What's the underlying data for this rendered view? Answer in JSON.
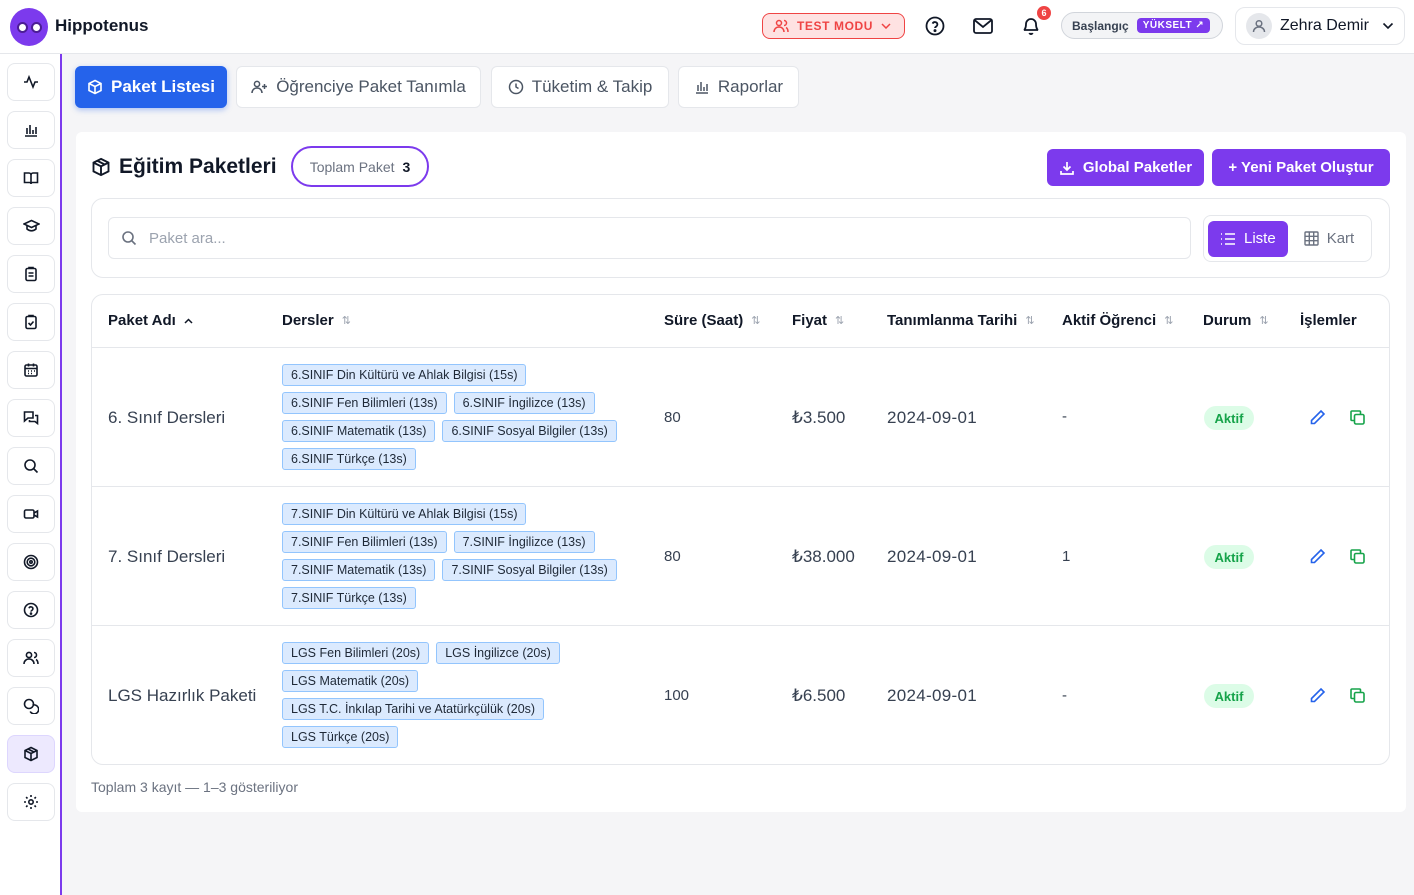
{
  "app": {
    "brand": "Hippotenus"
  },
  "header": {
    "test_mode": "TEST MODU",
    "notification_count": "6",
    "plan_label": "Başlangıç",
    "upgrade_label": "YÜKSELT ↗",
    "user_name": "Zehra Demir"
  },
  "tabs": [
    {
      "label": "Paket Listesi",
      "icon": "package-icon",
      "active": true
    },
    {
      "label": "Öğrenciye Paket Tanımla",
      "icon": "user-plus-icon",
      "active": false
    },
    {
      "label": "Tüketim & Takip",
      "icon": "clock-icon",
      "active": false
    },
    {
      "label": "Raporlar",
      "icon": "bar-chart-icon",
      "active": false
    }
  ],
  "panel": {
    "title": "Eğitim Paketleri",
    "total_label": "Toplam Paket",
    "total_value": "3",
    "global_button": "Global Paketler",
    "new_button": "+ Yeni Paket Oluştur"
  },
  "search": {
    "placeholder": "Paket ara..."
  },
  "view_toggle": {
    "list": "Liste",
    "card": "Kart",
    "active": "list"
  },
  "table": {
    "columns": [
      "Paket Adı",
      "Dersler",
      "Süre (Saat)",
      "Fiyat",
      "Tanımlanma Tarihi",
      "Aktif Öğrenci",
      "Durum",
      "İşlemler"
    ],
    "rows": [
      {
        "name": "6. Sınıf Dersleri",
        "courses": [
          "6.SINIF Din Kültürü ve Ahlak Bilgisi (15s)",
          "6.SINIF Fen Bilimleri (13s)",
          "6.SINIF İngilizce (13s)",
          "6.SINIF Matematik (13s)",
          "6.SINIF Sosyal Bilgiler (13s)",
          "6.SINIF Türkçe (13s)"
        ],
        "hours": "80",
        "price": "₺3.500",
        "date": "2024-09-01",
        "active_students": "-",
        "status": "Aktif"
      },
      {
        "name": "7. Sınıf Dersleri",
        "courses": [
          "7.SINIF Din Kültürü ve Ahlak Bilgisi (15s)",
          "7.SINIF Fen Bilimleri (13s)",
          "7.SINIF İngilizce (13s)",
          "7.SINIF Matematik (13s)",
          "7.SINIF Sosyal Bilgiler (13s)",
          "7.SINIF Türkçe (13s)"
        ],
        "hours": "80",
        "price": "₺38.000",
        "date": "2024-09-01",
        "active_students": "1",
        "status": "Aktif"
      },
      {
        "name": "LGS Hazırlık Paketi",
        "courses": [
          "LGS Fen Bilimleri (20s)",
          "LGS İngilizce (20s)",
          "LGS Matematik (20s)",
          "LGS T.C. İnkılap Tarihi ve Atatürkçülük (20s)",
          "LGS Türkçe (20s)"
        ],
        "hours": "100",
        "price": "₺6.500",
        "date": "2024-09-01",
        "active_students": "-",
        "status": "Aktif"
      }
    ]
  },
  "footer": {
    "summary": "Toplam 3 kayıt — 1–3 gösteriliyor"
  },
  "sidebar": {
    "icons": [
      "activity-icon",
      "bar-chart-icon",
      "book-open-icon",
      "graduation-cap-icon",
      "clipboard-list-icon",
      "clipboard-check-icon",
      "calendar-icon",
      "messages-icon",
      "search-icon",
      "video-icon",
      "target-icon",
      "help-circle-icon",
      "users-icon",
      "coins-icon",
      "package-icon",
      "settings-icon"
    ],
    "active": "package-icon"
  },
  "colors": {
    "accent": "#7c3aed",
    "primary_tab": "#2563eb",
    "status_green": "#16a34a",
    "test_red": "#ef4444"
  }
}
